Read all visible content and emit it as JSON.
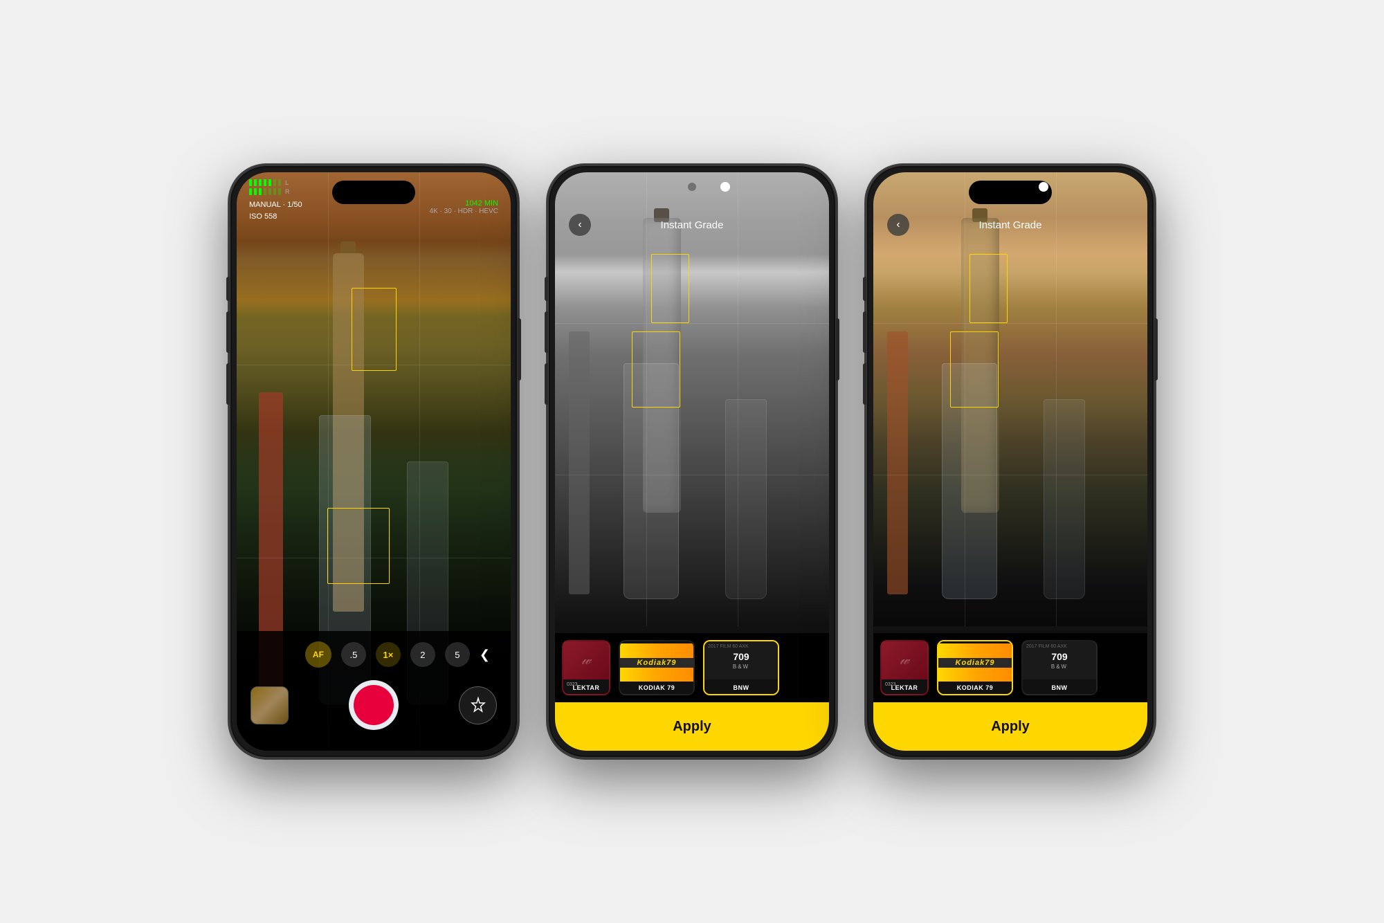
{
  "phones": [
    {
      "id": "phone1",
      "type": "camera",
      "hud": {
        "battery": "1042 MIN",
        "settings": "4K · 30 · HDR · HEVC",
        "mode": "MANUAL · 1/50",
        "iso": "ISO 558",
        "audio_left": "L",
        "audio_right": "R"
      },
      "controls": {
        "af_label": "AF",
        "zoom_levels": [
          ".5",
          "1×",
          "2",
          "5"
        ],
        "active_zoom": "1×"
      }
    },
    {
      "id": "phone2",
      "type": "grade",
      "header": {
        "back_icon": "‹",
        "title": "Instant Grade"
      },
      "filter": "bw",
      "film_cards": [
        {
          "id": "lektar",
          "label": "LEKTAR",
          "selected": false,
          "sub": "0323"
        },
        {
          "id": "kodiak",
          "label": "KODIAK 79",
          "selected": false
        },
        {
          "id": "bnw",
          "label": "BNW",
          "selected": true,
          "num": "709",
          "sub2": "B&W"
        }
      ],
      "apply_label": "Apply"
    },
    {
      "id": "phone3",
      "type": "grade",
      "header": {
        "back_icon": "‹",
        "title": "Instant Grade"
      },
      "filter": "color",
      "film_cards": [
        {
          "id": "lektar",
          "label": "LEKTAR",
          "selected": false,
          "sub": "0323"
        },
        {
          "id": "kodiak",
          "label": "KODIAK 79",
          "selected": true
        },
        {
          "id": "bnw",
          "label": "BNW",
          "selected": false,
          "num": "709",
          "sub2": "B&W"
        }
      ],
      "apply_label": "Apply"
    }
  ]
}
